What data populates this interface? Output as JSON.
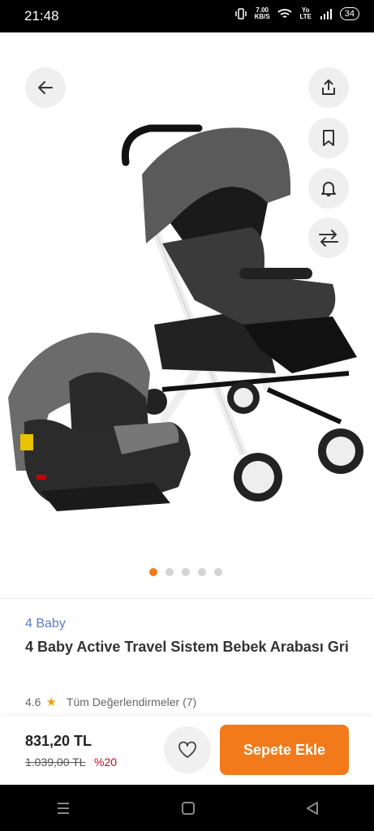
{
  "status_bar": {
    "time": "21:48",
    "speed_value": "7.00",
    "speed_unit": "KB/S",
    "network": "Yo LTE",
    "battery": "34"
  },
  "gallery": {
    "image_alt": "stroller-and-car-seat-product-photo",
    "dot_count": 5,
    "active_dot": 0
  },
  "product": {
    "brand": "4 Baby",
    "title": "4 Baby Active Travel Sistem Bebek Arabası Gri",
    "rating": "4.6",
    "reviews_label": "Tüm Değerlendirmeler (7)"
  },
  "purchase": {
    "price": "831,20 TL",
    "old_price": "1.039,00 TL",
    "discount": "%20",
    "add_to_cart_label": "Sepete Ekle"
  },
  "colors": {
    "accent": "#f27a1a",
    "brand_link": "#5c7cc7",
    "discount": "#d0021b"
  }
}
